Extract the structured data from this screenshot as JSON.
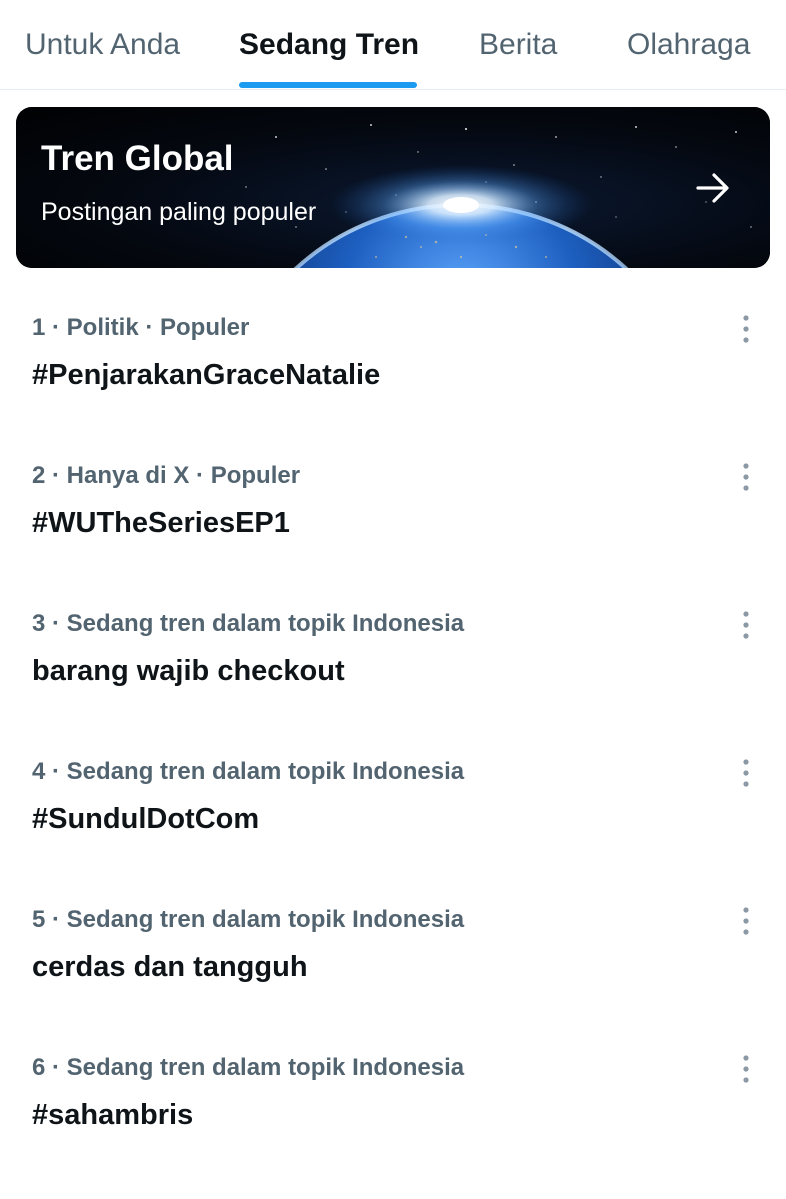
{
  "tabs": [
    {
      "label": "Untuk Anda",
      "active": false
    },
    {
      "label": "Sedang Tren",
      "active": true
    },
    {
      "label": "Berita",
      "active": false
    },
    {
      "label": "Olahraga",
      "active": false
    }
  ],
  "banner": {
    "title": "Tren Global",
    "subtitle": "Postingan paling populer",
    "arrow_icon": "arrow-right-icon"
  },
  "trends": [
    {
      "meta": "1 · Politik · Populer",
      "name": "#PenjarakanGraceNatalie"
    },
    {
      "meta": "2 · Hanya di X · Populer",
      "name": "#WUTheSeriesEP1"
    },
    {
      "meta": "3 · Sedang tren dalam topik Indonesia",
      "name": "barang wajib checkout"
    },
    {
      "meta": "4 · Sedang tren dalam topik Indonesia",
      "name": "#SundulDotCom"
    },
    {
      "meta": "5 · Sedang tren dalam topik Indonesia",
      "name": "cerdas dan tangguh"
    },
    {
      "meta": "6 · Sedang tren dalam topik Indonesia",
      "name": "#sahambris"
    }
  ],
  "colors": {
    "accent": "#1d9bf0",
    "text_primary": "#0f1419",
    "text_secondary": "#536471",
    "divider": "#e6ecf0"
  }
}
